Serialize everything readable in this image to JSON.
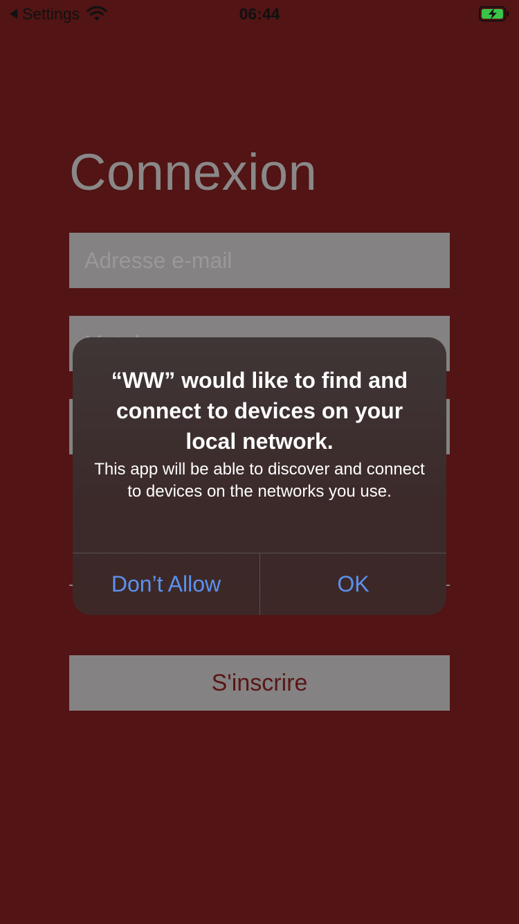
{
  "status_bar": {
    "back_label": "Settings",
    "time": "06:44",
    "icons": [
      "back-caret-icon",
      "wifi-icon",
      "battery-charging-icon"
    ]
  },
  "login": {
    "title": "Connexion",
    "email_placeholder": "Adresse e-mail",
    "password_placeholder": "Mot de passe",
    "register_label": "S'inscrire"
  },
  "alert": {
    "title": "“WW” would like to find and connect to devices on your local network.",
    "message": "This app will be able to discover and connect to devices on the networks you use.",
    "deny_label": "Don’t Allow",
    "ok_label": "OK"
  },
  "colors": {
    "background": "#521414",
    "field": "#848282",
    "title_text": "#8a8888",
    "alert_button_text": "#5b92ee",
    "battery_fill": "#3cc34a"
  }
}
